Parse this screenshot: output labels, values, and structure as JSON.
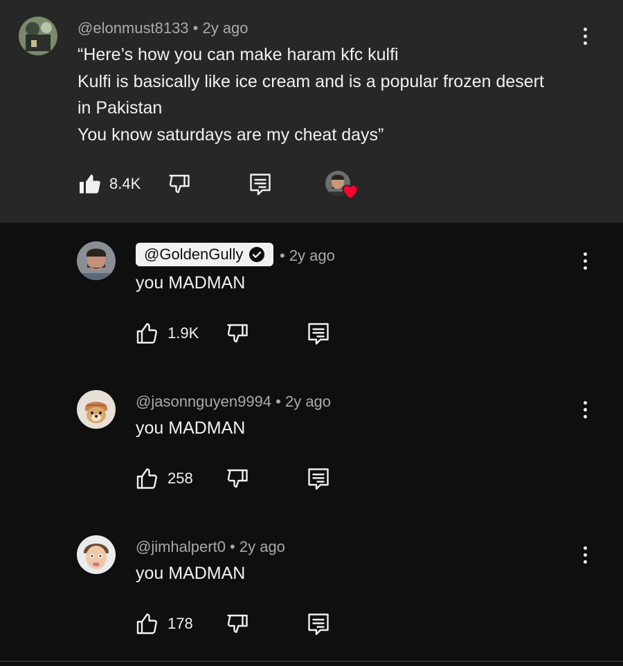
{
  "main_comment": {
    "author": "@elonmust8133",
    "time": " • 2y ago",
    "lines": [
      "“Here’s how you can make haram kfc kulfi",
      "Kulfi is basically like ice cream and is a popular frozen desert",
      "in Pakistan",
      "You know saturdays are my cheat days”"
    ],
    "likes": "8.4K",
    "liked": true,
    "creator_heart": true
  },
  "replies": [
    {
      "author": "@GoldenGully",
      "verified": true,
      "time": "• 2y ago",
      "text": "you MADMAN",
      "likes": "1.9K"
    },
    {
      "author": "@jasonnguyen9994",
      "verified": false,
      "time": " • 2y ago",
      "text": "you MADMAN",
      "likes": "258"
    },
    {
      "author": "@jimhalpert0",
      "verified": false,
      "time": " • 2y ago",
      "text": "you MADMAN",
      "likes": "178"
    }
  ],
  "colors": {
    "heart": "#ff0033",
    "background_main": "#272727",
    "background_replies": "#0f0f0f"
  },
  "icons": [
    "like-icon",
    "dislike-icon",
    "reply-icon",
    "more-vert-icon",
    "verified-check-icon",
    "heart-icon"
  ]
}
